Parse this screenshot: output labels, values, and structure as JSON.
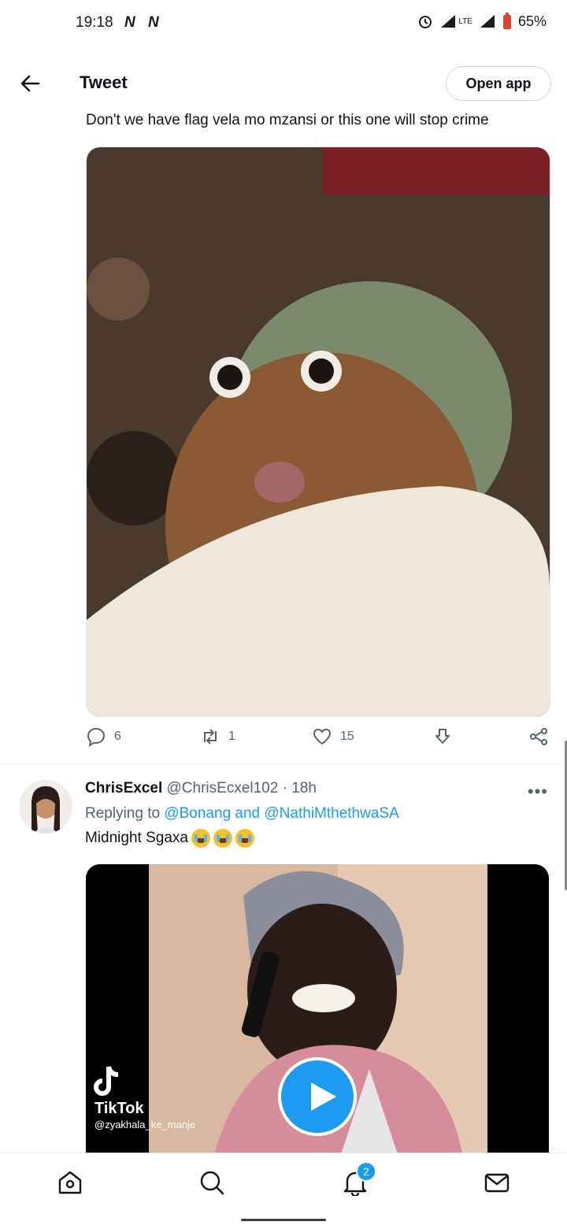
{
  "status_bar": {
    "time": "19:18",
    "notification_icons": [
      "N",
      "N"
    ],
    "network": "LTE",
    "battery": "65%"
  },
  "header": {
    "title": "Tweet",
    "open_app_label": "Open app"
  },
  "main_tweet": {
    "text": "Don't we have flag vela mo mzansi or this one will stop crime",
    "media": "photo",
    "actions": {
      "replies": "6",
      "retweets": "1",
      "likes": "15"
    }
  },
  "reply_tweet": {
    "display_name": "ChrisExcel",
    "handle": "@ChrisEcxel102",
    "time": "· 18h",
    "replying_prefix": "Replying to ",
    "replying_to": "@Bonang and @NathiMthethwaSA",
    "text": "Midnight Sgaxa",
    "emoji": [
      "loudly-crying-face",
      "loudly-crying-face",
      "loudly-crying-face"
    ],
    "video": {
      "watermark_brand": "TikTok",
      "watermark_handle": "@zyakhala_ke_manje"
    }
  },
  "bottom_nav": {
    "items": [
      "home-icon",
      "search-icon",
      "notifications-icon",
      "messages-icon"
    ],
    "notification_count": "2"
  },
  "colors": {
    "accent": "#1d9bf0",
    "text": "#0f1419",
    "secondary": "#536471"
  }
}
